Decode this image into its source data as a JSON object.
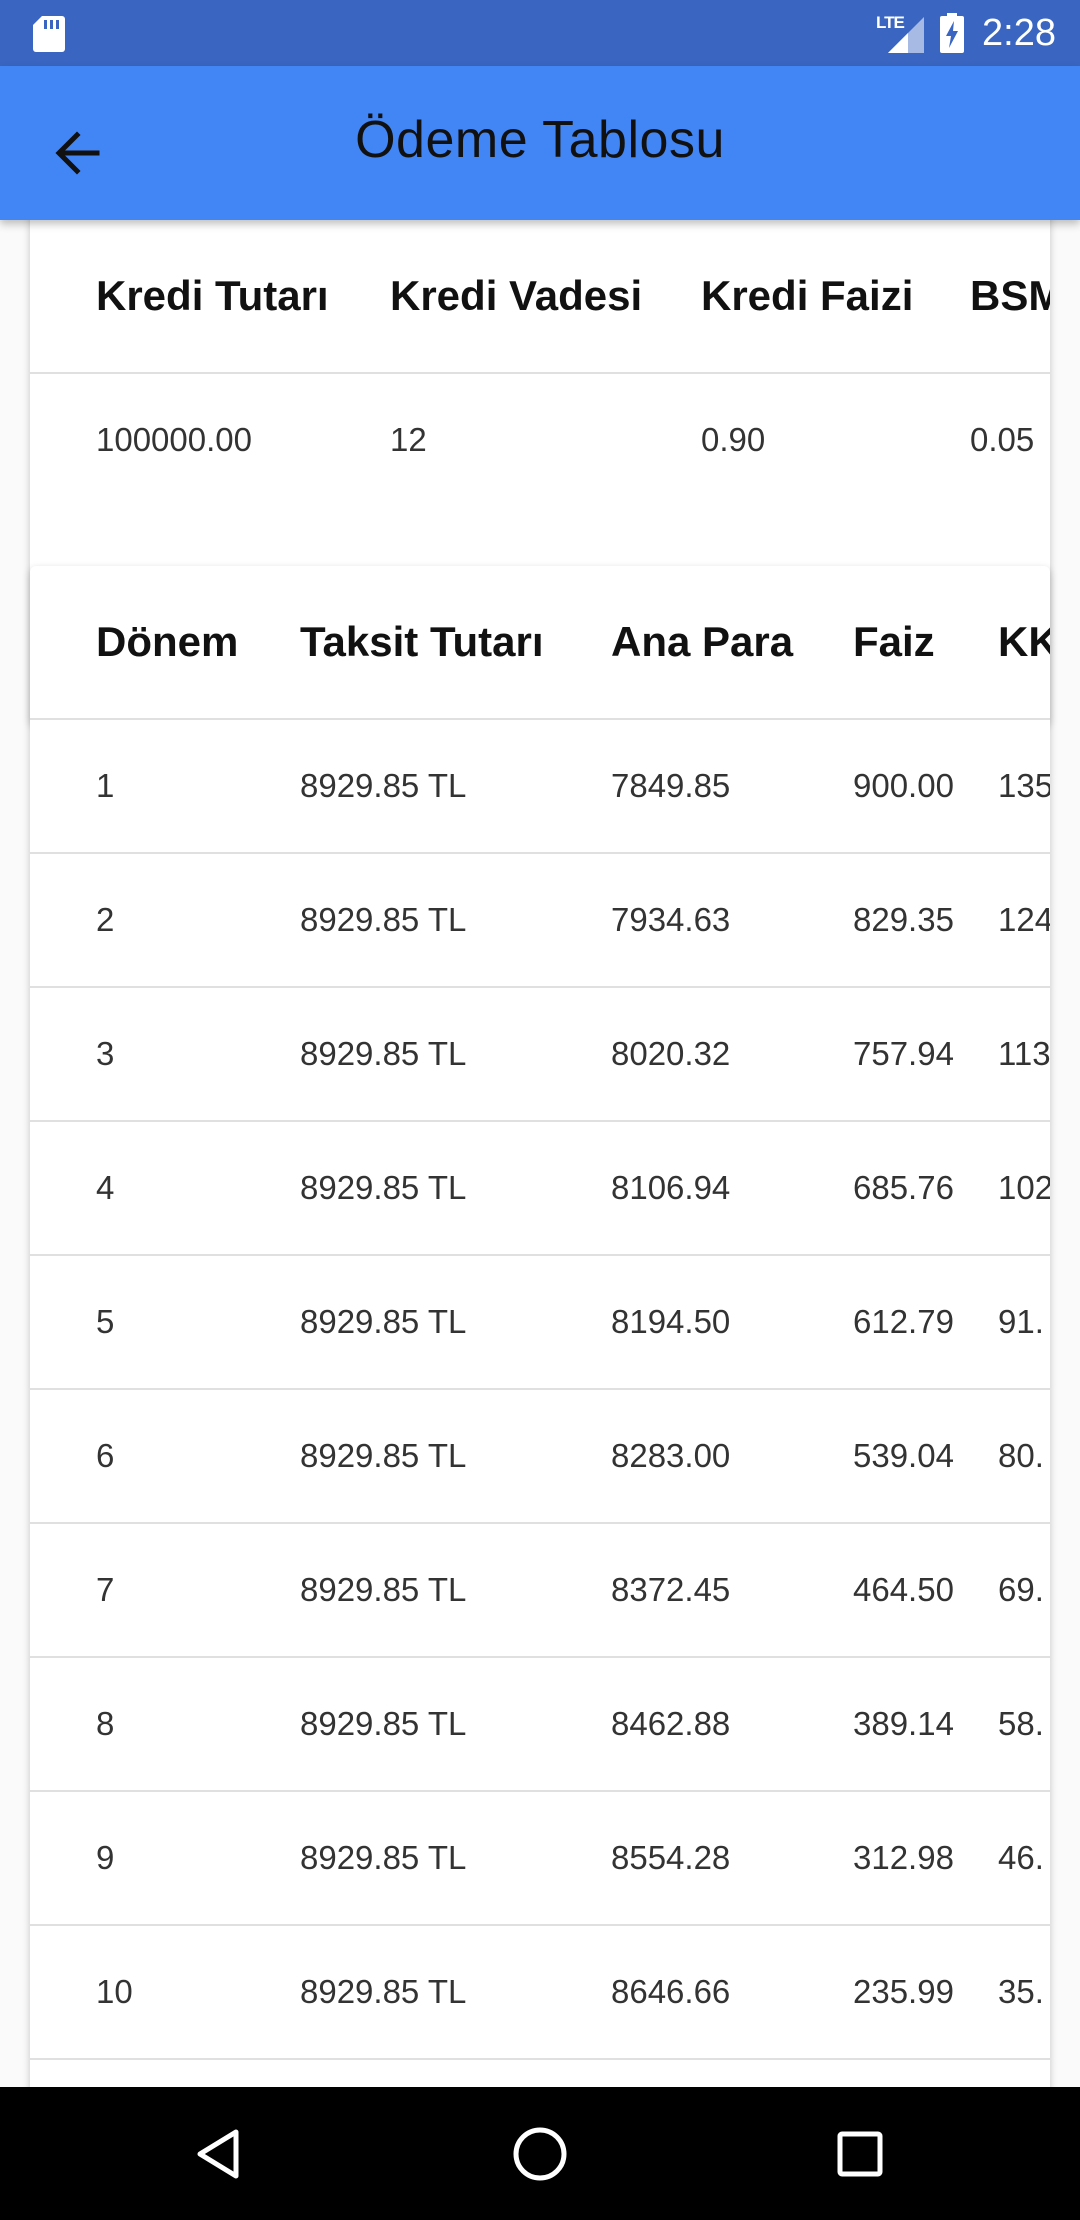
{
  "status_bar": {
    "network": "LTE",
    "time": "2:28",
    "icons": [
      "sd-card-icon",
      "signal-icon",
      "battery-charging-icon"
    ]
  },
  "app_bar": {
    "title": "Ödeme Tablosu",
    "back_icon": "arrow-left-icon"
  },
  "summary_table": {
    "headers": [
      "Kredi Tutarı",
      "Kredi Vadesi",
      "Kredi Faizi",
      "BSM"
    ],
    "values": [
      "100000.00",
      "12",
      "0.90",
      "0.05"
    ]
  },
  "schedule_table": {
    "headers": [
      "Dönem",
      "Taksit Tutarı",
      "Ana Para",
      "Faiz",
      "KK"
    ],
    "rows": [
      [
        "1",
        "8929.85 TL",
        "7849.85",
        "900.00",
        "135"
      ],
      [
        "2",
        "8929.85 TL",
        "7934.63",
        "829.35",
        "124"
      ],
      [
        "3",
        "8929.85 TL",
        "8020.32",
        "757.94",
        "113"
      ],
      [
        "4",
        "8929.85 TL",
        "8106.94",
        "685.76",
        "102"
      ],
      [
        "5",
        "8929.85 TL",
        "8194.50",
        "612.79",
        "91."
      ],
      [
        "6",
        "8929.85 TL",
        "8283.00",
        "539.04",
        "80."
      ],
      [
        "7",
        "8929.85 TL",
        "8372.45",
        "464.50",
        "69."
      ],
      [
        "8",
        "8929.85 TL",
        "8462.88",
        "389.14",
        "58."
      ],
      [
        "9",
        "8929.85 TL",
        "8554.28",
        "312.98",
        "46."
      ],
      [
        "10",
        "8929.85 TL",
        "8646.66",
        "235.99",
        "35."
      ]
    ]
  },
  "nav_bar": {
    "icons": [
      "back-triangle-icon",
      "home-circle-icon",
      "recents-square-icon"
    ]
  }
}
